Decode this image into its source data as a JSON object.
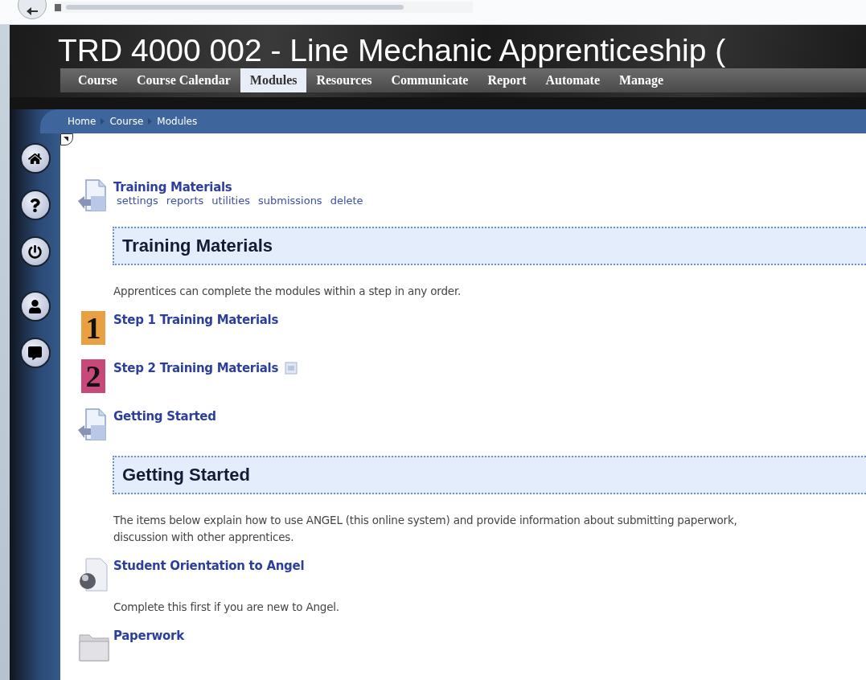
{
  "course_title": "TRD 4000 002 - Line Mechanic Apprenticeship (",
  "nav_tabs": [
    {
      "label": "Course",
      "selected": false
    },
    {
      "label": "Course Calendar",
      "selected": false
    },
    {
      "label": "Modules",
      "selected": true
    },
    {
      "label": "Resources",
      "selected": false
    },
    {
      "label": "Communicate",
      "selected": false
    },
    {
      "label": "Report",
      "selected": false
    },
    {
      "label": "Automate",
      "selected": false
    },
    {
      "label": "Manage",
      "selected": false
    }
  ],
  "breadcrumb": [
    "Home",
    "Course",
    "Modules"
  ],
  "sidebar_buttons": [
    {
      "kind": "home"
    },
    {
      "kind": "help"
    },
    {
      "kind": "power"
    },
    {
      "kind": "profile"
    },
    {
      "kind": "chat"
    }
  ],
  "content": [
    {
      "kind": "page",
      "title": "Training Materials",
      "actions": [
        "settings",
        "reports",
        "utilities",
        "submissions",
        "delete"
      ]
    },
    {
      "kind": "heading",
      "text": "Training Materials"
    },
    {
      "kind": "description",
      "lines": [
        "Apprentices can complete the modules within a step in any order."
      ]
    },
    {
      "kind": "step",
      "number": "1",
      "color": "#e8a040",
      "title": "Step 1 Training Materials",
      "has_note": false
    },
    {
      "kind": "step",
      "number": "2",
      "color": "#c8487a",
      "title": "Step 2 Training Materials",
      "has_note": true
    },
    {
      "kind": "page",
      "title": "Getting Started"
    },
    {
      "kind": "heading",
      "text": "Getting Started"
    },
    {
      "kind": "description",
      "lines": [
        "The items below explain how to use ANGEL (this online system) and provide information about submitting paperwork, ",
        "discussion with other apprentices."
      ]
    },
    {
      "kind": "link",
      "title": "Student Orientation to Angel"
    },
    {
      "kind": "description",
      "lines": [
        "Complete this first if you are new to Angel."
      ]
    },
    {
      "kind": "folder",
      "title": "Paperwork"
    }
  ]
}
